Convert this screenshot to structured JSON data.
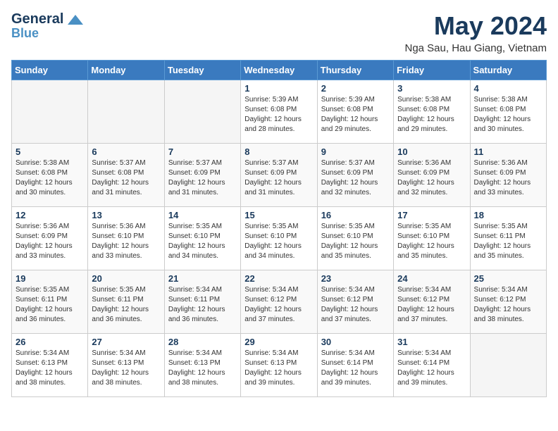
{
  "header": {
    "logo_line1": "General",
    "logo_line2": "Blue",
    "month": "May 2024",
    "location": "Nga Sau, Hau Giang, Vietnam"
  },
  "weekdays": [
    "Sunday",
    "Monday",
    "Tuesday",
    "Wednesday",
    "Thursday",
    "Friday",
    "Saturday"
  ],
  "weeks": [
    [
      {
        "day": "",
        "empty": true
      },
      {
        "day": "",
        "empty": true
      },
      {
        "day": "",
        "empty": true
      },
      {
        "day": "1",
        "info": "Sunrise: 5:39 AM\nSunset: 6:08 PM\nDaylight: 12 hours\nand 28 minutes."
      },
      {
        "day": "2",
        "info": "Sunrise: 5:39 AM\nSunset: 6:08 PM\nDaylight: 12 hours\nand 29 minutes."
      },
      {
        "day": "3",
        "info": "Sunrise: 5:38 AM\nSunset: 6:08 PM\nDaylight: 12 hours\nand 29 minutes."
      },
      {
        "day": "4",
        "info": "Sunrise: 5:38 AM\nSunset: 6:08 PM\nDaylight: 12 hours\nand 30 minutes."
      }
    ],
    [
      {
        "day": "5",
        "info": "Sunrise: 5:38 AM\nSunset: 6:08 PM\nDaylight: 12 hours\nand 30 minutes."
      },
      {
        "day": "6",
        "info": "Sunrise: 5:37 AM\nSunset: 6:08 PM\nDaylight: 12 hours\nand 31 minutes."
      },
      {
        "day": "7",
        "info": "Sunrise: 5:37 AM\nSunset: 6:09 PM\nDaylight: 12 hours\nand 31 minutes."
      },
      {
        "day": "8",
        "info": "Sunrise: 5:37 AM\nSunset: 6:09 PM\nDaylight: 12 hours\nand 31 minutes."
      },
      {
        "day": "9",
        "info": "Sunrise: 5:37 AM\nSunset: 6:09 PM\nDaylight: 12 hours\nand 32 minutes."
      },
      {
        "day": "10",
        "info": "Sunrise: 5:36 AM\nSunset: 6:09 PM\nDaylight: 12 hours\nand 32 minutes."
      },
      {
        "day": "11",
        "info": "Sunrise: 5:36 AM\nSunset: 6:09 PM\nDaylight: 12 hours\nand 33 minutes."
      }
    ],
    [
      {
        "day": "12",
        "info": "Sunrise: 5:36 AM\nSunset: 6:09 PM\nDaylight: 12 hours\nand 33 minutes."
      },
      {
        "day": "13",
        "info": "Sunrise: 5:36 AM\nSunset: 6:10 PM\nDaylight: 12 hours\nand 33 minutes."
      },
      {
        "day": "14",
        "info": "Sunrise: 5:35 AM\nSunset: 6:10 PM\nDaylight: 12 hours\nand 34 minutes."
      },
      {
        "day": "15",
        "info": "Sunrise: 5:35 AM\nSunset: 6:10 PM\nDaylight: 12 hours\nand 34 minutes."
      },
      {
        "day": "16",
        "info": "Sunrise: 5:35 AM\nSunset: 6:10 PM\nDaylight: 12 hours\nand 35 minutes."
      },
      {
        "day": "17",
        "info": "Sunrise: 5:35 AM\nSunset: 6:10 PM\nDaylight: 12 hours\nand 35 minutes."
      },
      {
        "day": "18",
        "info": "Sunrise: 5:35 AM\nSunset: 6:11 PM\nDaylight: 12 hours\nand 35 minutes."
      }
    ],
    [
      {
        "day": "19",
        "info": "Sunrise: 5:35 AM\nSunset: 6:11 PM\nDaylight: 12 hours\nand 36 minutes."
      },
      {
        "day": "20",
        "info": "Sunrise: 5:35 AM\nSunset: 6:11 PM\nDaylight: 12 hours\nand 36 minutes."
      },
      {
        "day": "21",
        "info": "Sunrise: 5:34 AM\nSunset: 6:11 PM\nDaylight: 12 hours\nand 36 minutes."
      },
      {
        "day": "22",
        "info": "Sunrise: 5:34 AM\nSunset: 6:12 PM\nDaylight: 12 hours\nand 37 minutes."
      },
      {
        "day": "23",
        "info": "Sunrise: 5:34 AM\nSunset: 6:12 PM\nDaylight: 12 hours\nand 37 minutes."
      },
      {
        "day": "24",
        "info": "Sunrise: 5:34 AM\nSunset: 6:12 PM\nDaylight: 12 hours\nand 37 minutes."
      },
      {
        "day": "25",
        "info": "Sunrise: 5:34 AM\nSunset: 6:12 PM\nDaylight: 12 hours\nand 38 minutes."
      }
    ],
    [
      {
        "day": "26",
        "info": "Sunrise: 5:34 AM\nSunset: 6:13 PM\nDaylight: 12 hours\nand 38 minutes."
      },
      {
        "day": "27",
        "info": "Sunrise: 5:34 AM\nSunset: 6:13 PM\nDaylight: 12 hours\nand 38 minutes."
      },
      {
        "day": "28",
        "info": "Sunrise: 5:34 AM\nSunset: 6:13 PM\nDaylight: 12 hours\nand 38 minutes."
      },
      {
        "day": "29",
        "info": "Sunrise: 5:34 AM\nSunset: 6:13 PM\nDaylight: 12 hours\nand 39 minutes."
      },
      {
        "day": "30",
        "info": "Sunrise: 5:34 AM\nSunset: 6:14 PM\nDaylight: 12 hours\nand 39 minutes."
      },
      {
        "day": "31",
        "info": "Sunrise: 5:34 AM\nSunset: 6:14 PM\nDaylight: 12 hours\nand 39 minutes."
      },
      {
        "day": "",
        "empty": true
      }
    ]
  ]
}
